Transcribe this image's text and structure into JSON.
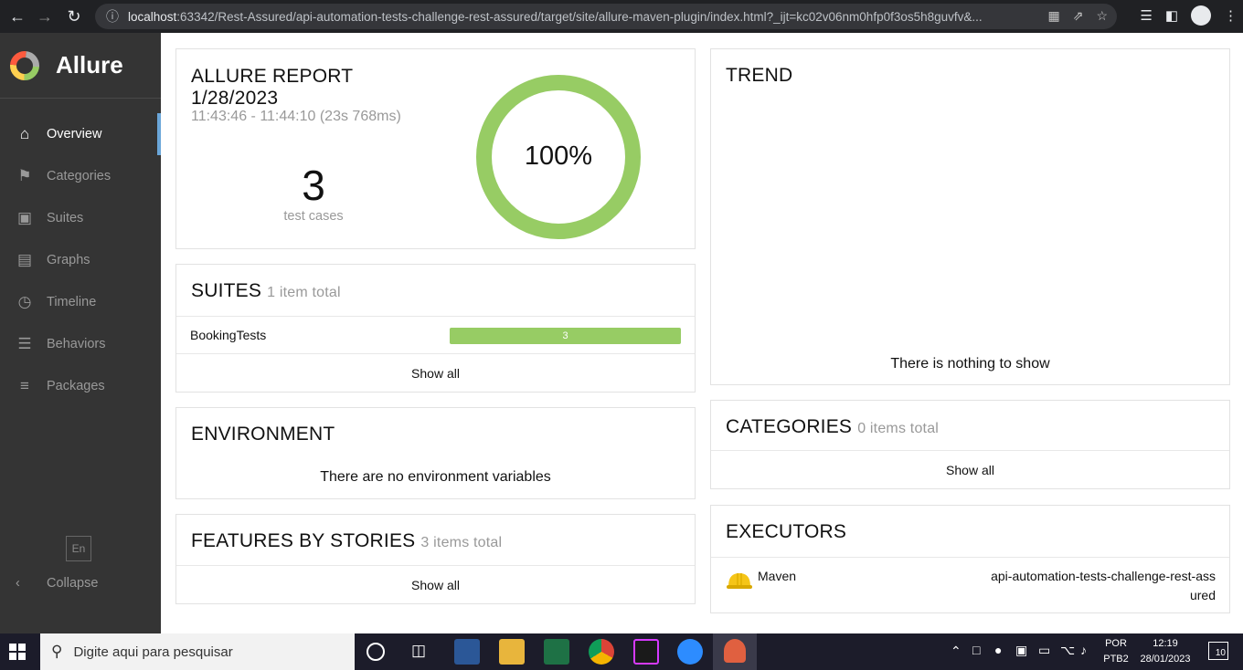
{
  "browser": {
    "url_host": "localhost",
    "url_rest": ":63342/Rest-Assured/api-automation-tests-challenge-rest-assured/target/site/allure-maven-plugin/index.html?_ijt=kc02v06nm0hfp0f3os5h8guvfv&..."
  },
  "sidebar": {
    "brand": "Allure",
    "items": [
      {
        "label": "Overview",
        "icon": "home-icon"
      },
      {
        "label": "Categories",
        "icon": "flag-icon"
      },
      {
        "label": "Suites",
        "icon": "briefcase-icon"
      },
      {
        "label": "Graphs",
        "icon": "bar-chart-icon"
      },
      {
        "label": "Timeline",
        "icon": "clock-icon"
      },
      {
        "label": "Behaviors",
        "icon": "list-icon"
      },
      {
        "label": "Packages",
        "icon": "align-left-icon"
      }
    ],
    "lang": "En",
    "collapse": "Collapse"
  },
  "report": {
    "title": "ALLURE REPORT",
    "date": "1/28/2023",
    "time": "11:43:46 - 11:44:10 (23s 768ms)",
    "count": "3",
    "count_label": "test cases",
    "percent": "100%",
    "pass_fraction": 1.0
  },
  "suites": {
    "title": "SUITES",
    "total": "1 item total",
    "rows": [
      {
        "name": "BookingTests",
        "passed": "3"
      }
    ],
    "show_all": "Show all"
  },
  "environment": {
    "title": "ENVIRONMENT",
    "empty": "There are no environment variables"
  },
  "features": {
    "title": "FEATURES BY STORIES",
    "total": "3 items total",
    "show_all": "Show all"
  },
  "trend": {
    "title": "TREND",
    "empty": "There is nothing to show"
  },
  "categories": {
    "title": "CATEGORIES",
    "total": "0 items total",
    "show_all": "Show all"
  },
  "executors": {
    "title": "EXECUTORS",
    "name": "Maven",
    "build_line1": "api-automation-tests-challenge-rest-ass",
    "build_line2": "ured"
  },
  "taskbar": {
    "search_placeholder": "Digite aqui para pesquisar",
    "lang1": "POR",
    "lang2": "PTB2",
    "time": "12:19",
    "date": "28/01/2023",
    "notifications": "10"
  },
  "colors": {
    "accent": "#97cc64",
    "sidebar": "#343434",
    "active_marker": "#6aa6d9"
  }
}
